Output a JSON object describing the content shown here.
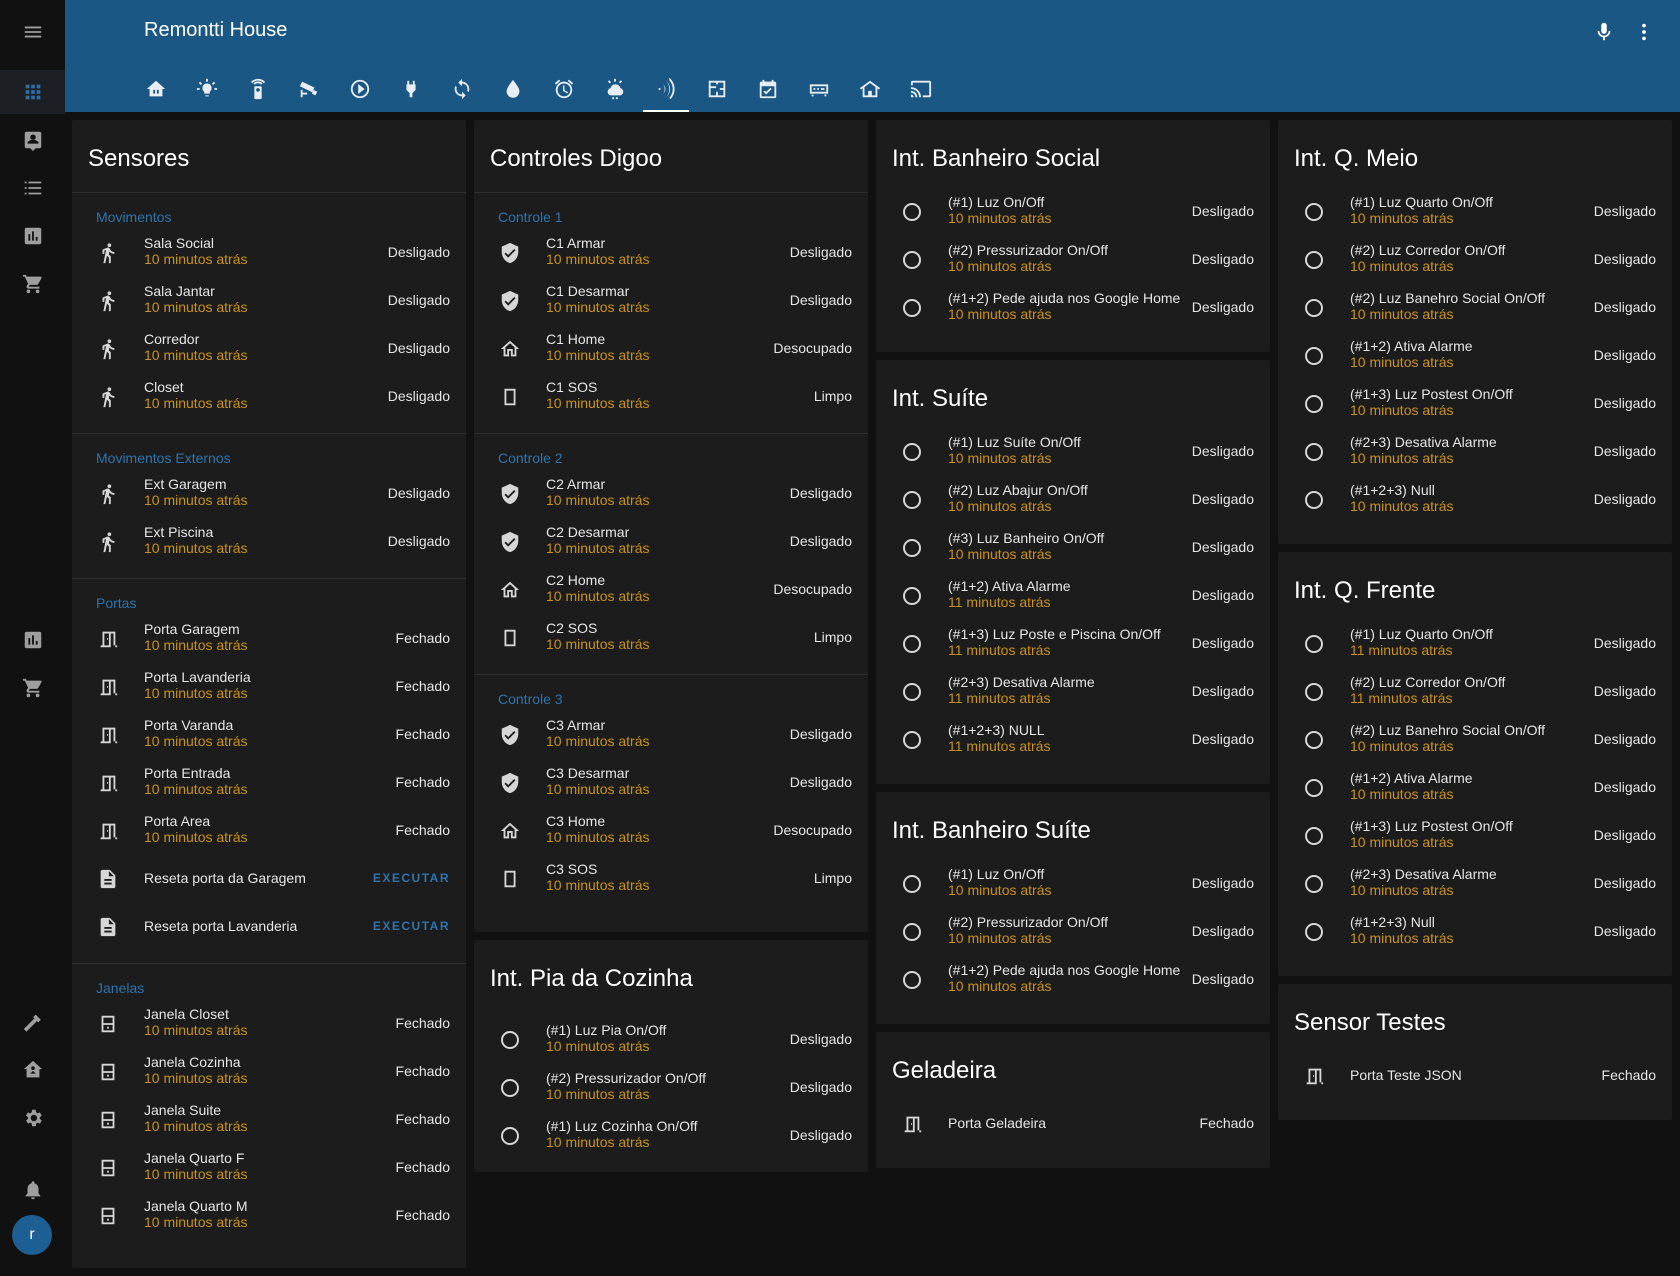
{
  "app": {
    "title": "Remontti House",
    "user_initial": "r"
  },
  "colors": {
    "header": "#1b5785",
    "accent": "#2d74ad",
    "secondary_text": "#c8921b",
    "card": "#1c1c1c",
    "background": "#111111"
  },
  "sidebar": {
    "items": [
      "menu-icon",
      "overview-icon",
      "map-icon",
      "logbook-icon",
      "history-icon",
      "shopping-cart-icon",
      "energy-icon",
      "shopping-list-icon",
      "developer-tools-icon",
      "home-assistant-icon",
      "settings-icon",
      "notifications-icon"
    ]
  },
  "header_actions": [
    "microphone-icon",
    "more-vert-icon"
  ],
  "tabs": [
    "home-icon",
    "lightbulb-icon",
    "remote-icon",
    "cctv-icon",
    "media-icon",
    "power-plug-icon",
    "sync-icon",
    "water-icon",
    "alarm-icon",
    "weather-icon",
    "wifi-signal-icon",
    "floorplan-icon",
    "calendar-icon",
    "receiver-icon",
    "house-icon",
    "cast-icon"
  ],
  "cards": {
    "sensores": {
      "title": "Sensores",
      "sections": [
        {
          "label": "Movimentos",
          "rows": [
            {
              "name": "Sala Social",
              "sub": "10 minutos atrás",
              "state": "Desligado"
            },
            {
              "name": "Sala Jantar",
              "sub": "10 minutos atrás",
              "state": "Desligado"
            },
            {
              "name": "Corredor",
              "sub": "10 minutos atrás",
              "state": "Desligado"
            },
            {
              "name": "Closet",
              "sub": "10 minutos atrás",
              "state": "Desligado"
            }
          ]
        },
        {
          "label": "Movimentos Externos",
          "rows": [
            {
              "name": "Ext Garagem",
              "sub": "10 minutos atrás",
              "state": "Desligado"
            },
            {
              "name": "Ext Piscina",
              "sub": "10 minutos atrás",
              "state": "Desligado"
            }
          ]
        },
        {
          "label": "Portas",
          "rows": [
            {
              "name": "Porta Garagem",
              "sub": "10 minutos atrás",
              "state": "Fechado"
            },
            {
              "name": "Porta Lavanderia",
              "sub": "10 minutos atrás",
              "state": "Fechado"
            },
            {
              "name": "Porta Varanda",
              "sub": "10 minutos atrás",
              "state": "Fechado"
            },
            {
              "name": "Porta Entrada",
              "sub": "10 minutos atrás",
              "state": "Fechado"
            },
            {
              "name": "Porta Area",
              "sub": "10 minutos atrás",
              "state": "Fechado"
            },
            {
              "name": "Reseta porta da Garagem",
              "action": "EXECUTAR"
            },
            {
              "name": "Reseta porta Lavanderia",
              "action": "EXECUTAR"
            }
          ]
        },
        {
          "label": "Janelas",
          "rows": [
            {
              "name": "Janela Closet",
              "sub": "10 minutos atrás",
              "state": "Fechado"
            },
            {
              "name": "Janela Cozinha",
              "sub": "10 minutos atrás",
              "state": "Fechado"
            },
            {
              "name": "Janela Suite",
              "sub": "10 minutos atrás",
              "state": "Fechado"
            },
            {
              "name": "Janela Quarto F",
              "sub": "10 minutos atrás",
              "state": "Fechado"
            },
            {
              "name": "Janela Quarto M",
              "sub": "10 minutos atrás",
              "state": "Fechado"
            }
          ]
        }
      ]
    },
    "controles": {
      "title": "Controles Digoo",
      "sections": [
        {
          "label": "Controle 1",
          "rows": [
            {
              "name": "C1 Armar",
              "sub": "10 minutos atrás",
              "state": "Desligado"
            },
            {
              "name": "C1 Desarmar",
              "sub": "10 minutos atrás",
              "state": "Desligado"
            },
            {
              "name": "C1 Home",
              "sub": "10 minutos atrás",
              "state": "Desocupado"
            },
            {
              "name": "C1 SOS",
              "sub": "10 minutos atrás",
              "state": "Limpo"
            }
          ]
        },
        {
          "label": "Controle 2",
          "rows": [
            {
              "name": "C2 Armar",
              "sub": "10 minutos atrás",
              "state": "Desligado"
            },
            {
              "name": "C2 Desarmar",
              "sub": "10 minutos atrás",
              "state": "Desligado"
            },
            {
              "name": "C2 Home",
              "sub": "10 minutos atrás",
              "state": "Desocupado"
            },
            {
              "name": "C2 SOS",
              "sub": "10 minutos atrás",
              "state": "Limpo"
            }
          ]
        },
        {
          "label": "Controle 3",
          "rows": [
            {
              "name": "C3 Armar",
              "sub": "10 minutos atrás",
              "state": "Desligado"
            },
            {
              "name": "C3 Desarmar",
              "sub": "10 minutos atrás",
              "state": "Desligado"
            },
            {
              "name": "C3 Home",
              "sub": "10 minutos atrás",
              "state": "Desocupado"
            },
            {
              "name": "C3 SOS",
              "sub": "10 minutos atrás",
              "state": "Limpo"
            }
          ]
        }
      ]
    },
    "pia": {
      "title": "Int. Pia da Cozinha",
      "rows": [
        {
          "name": "(#1) Luz Pia On/Off",
          "sub": "10 minutos atrás",
          "state": "Desligado"
        },
        {
          "name": "(#2) Pressurizador On/Off",
          "sub": "10 minutos atrás",
          "state": "Desligado"
        },
        {
          "name": "(#1) Luz Cozinha On/Off",
          "sub": "10 minutos atrás",
          "state": "Desligado"
        }
      ]
    },
    "banheiro_social": {
      "title": "Int. Banheiro Social",
      "rows": [
        {
          "name": "(#1) Luz On/Off",
          "sub": "10 minutos atrás",
          "state": "Desligado"
        },
        {
          "name": "(#2) Pressurizador On/Off",
          "sub": "10 minutos atrás",
          "state": "Desligado"
        },
        {
          "name": "(#1+2) Pede ajuda nos Google Home",
          "sub": "10 minutos atrás",
          "state": "Desligado"
        }
      ]
    },
    "suite": {
      "title": "Int. Suíte",
      "rows": [
        {
          "name": "(#1) Luz Suíte On/Off",
          "sub": "10 minutos atrás",
          "state": "Desligado"
        },
        {
          "name": "(#2) Luz Abajur On/Off",
          "sub": "10 minutos atrás",
          "state": "Desligado"
        },
        {
          "name": "(#3) Luz Banheiro On/Off",
          "sub": "10 minutos atrás",
          "state": "Desligado"
        },
        {
          "name": "(#1+2) Ativa Alarme",
          "sub": "11 minutos atrás",
          "state": "Desligado"
        },
        {
          "name": "(#1+3) Luz Poste e Piscina On/Off",
          "sub": "11 minutos atrás",
          "state": "Desligado"
        },
        {
          "name": "(#2+3) Desativa Alarme",
          "sub": "11 minutos atrás",
          "state": "Desligado"
        },
        {
          "name": "(#1+2+3) NULL",
          "sub": "11 minutos atrás",
          "state": "Desligado"
        }
      ]
    },
    "banheiro_suite": {
      "title": "Int. Banheiro Suíte",
      "rows": [
        {
          "name": "(#1) Luz On/Off",
          "sub": "10 minutos atrás",
          "state": "Desligado"
        },
        {
          "name": "(#2) Pressurizador On/Off",
          "sub": "10 minutos atrás",
          "state": "Desligado"
        },
        {
          "name": "(#1+2) Pede ajuda nos Google Home",
          "sub": "10 minutos atrás",
          "state": "Desligado"
        }
      ]
    },
    "geladeira": {
      "title": "Geladeira",
      "rows": [
        {
          "name": "Porta Geladeira",
          "state": "Fechado"
        }
      ]
    },
    "q_meio": {
      "title": "Int. Q. Meio",
      "rows": [
        {
          "name": "(#1) Luz Quarto On/Off",
          "sub": "10 minutos atrás",
          "state": "Desligado"
        },
        {
          "name": "(#2) Luz Corredor On/Off",
          "sub": "10 minutos atrás",
          "state": "Desligado"
        },
        {
          "name": "(#2) Luz Banehro Social On/Off",
          "sub": "10 minutos atrás",
          "state": "Desligado"
        },
        {
          "name": "(#1+2) Ativa Alarme",
          "sub": "10 minutos atrás",
          "state": "Desligado"
        },
        {
          "name": "(#1+3) Luz Postest On/Off",
          "sub": "10 minutos atrás",
          "state": "Desligado"
        },
        {
          "name": "(#2+3) Desativa Alarme",
          "sub": "10 minutos atrás",
          "state": "Desligado"
        },
        {
          "name": "(#1+2+3) Null",
          "sub": "10 minutos atrás",
          "state": "Desligado"
        }
      ]
    },
    "q_frente": {
      "title": "Int. Q. Frente",
      "rows": [
        {
          "name": "(#1) Luz Quarto On/Off",
          "sub": "11 minutos atrás",
          "state": "Desligado"
        },
        {
          "name": "(#2) Luz Corredor On/Off",
          "sub": "11 minutos atrás",
          "state": "Desligado"
        },
        {
          "name": "(#2) Luz Banehro Social On/Off",
          "sub": "10 minutos atrás",
          "state": "Desligado"
        },
        {
          "name": "(#1+2) Ativa Alarme",
          "sub": "10 minutos atrás",
          "state": "Desligado"
        },
        {
          "name": "(#1+3) Luz Postest On/Off",
          "sub": "10 minutos atrás",
          "state": "Desligado"
        },
        {
          "name": "(#2+3) Desativa Alarme",
          "sub": "10 minutos atrás",
          "state": "Desligado"
        },
        {
          "name": "(#1+2+3) Null",
          "sub": "10 minutos atrás",
          "state": "Desligado"
        }
      ]
    },
    "sensor_testes": {
      "title": "Sensor Testes",
      "rows": [
        {
          "name": "Porta Teste JSON",
          "state": "Fechado"
        }
      ]
    }
  }
}
